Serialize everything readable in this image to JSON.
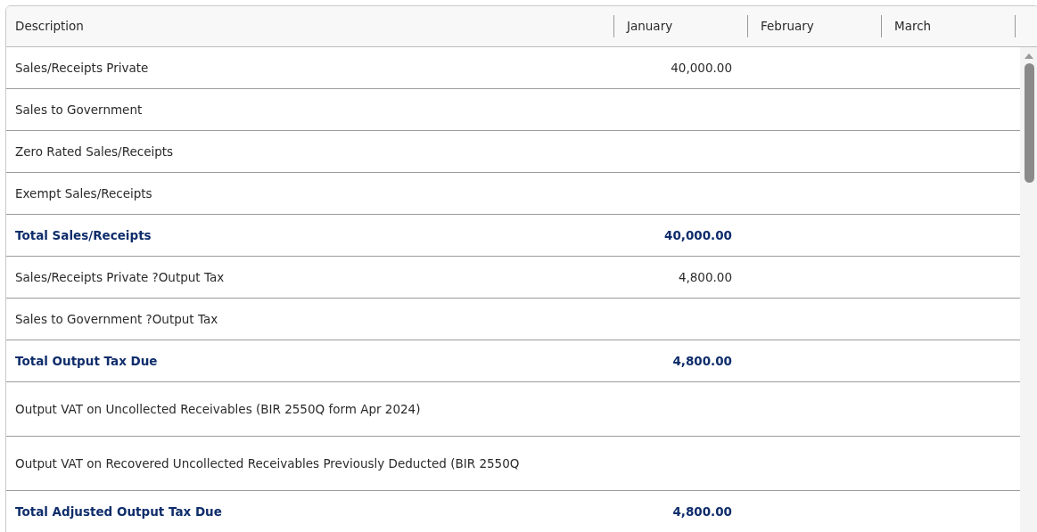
{
  "table": {
    "columns": [
      "Description",
      "January",
      "February",
      "March"
    ],
    "rows": [
      {
        "kind": "item",
        "cells": [
          "Sales/Receipts Private",
          "40,000.00",
          "",
          ""
        ]
      },
      {
        "kind": "item",
        "cells": [
          "Sales to Government",
          "",
          "",
          ""
        ]
      },
      {
        "kind": "item",
        "cells": [
          "Zero Rated Sales/Receipts",
          "",
          "",
          ""
        ]
      },
      {
        "kind": "item",
        "cells": [
          "Exempt Sales/Receipts",
          "",
          "",
          ""
        ]
      },
      {
        "kind": "total",
        "cells": [
          "Total Sales/Receipts",
          "40,000.00",
          "",
          ""
        ]
      },
      {
        "kind": "item",
        "cells": [
          "Sales/Receipts Private ?Output Tax",
          "4,800.00",
          "",
          ""
        ]
      },
      {
        "kind": "item",
        "cells": [
          "Sales to Government ?Output Tax",
          "",
          "",
          ""
        ]
      },
      {
        "kind": "total",
        "cells": [
          "Total Output Tax Due",
          "4,800.00",
          "",
          ""
        ]
      },
      {
        "kind": "note",
        "cells": [
          "Output VAT on Uncollected Receivables (BIR 2550Q form Apr 2024)",
          "",
          "",
          ""
        ]
      },
      {
        "kind": "note",
        "cells": [
          "Output VAT on Recovered Uncollected Receivables Previously Deducted (BIR 2550Q",
          "",
          "",
          ""
        ]
      },
      {
        "kind": "total",
        "cells": [
          "Total Adjusted Output Tax Due",
          "4,800.00",
          "",
          ""
        ]
      }
    ]
  }
}
